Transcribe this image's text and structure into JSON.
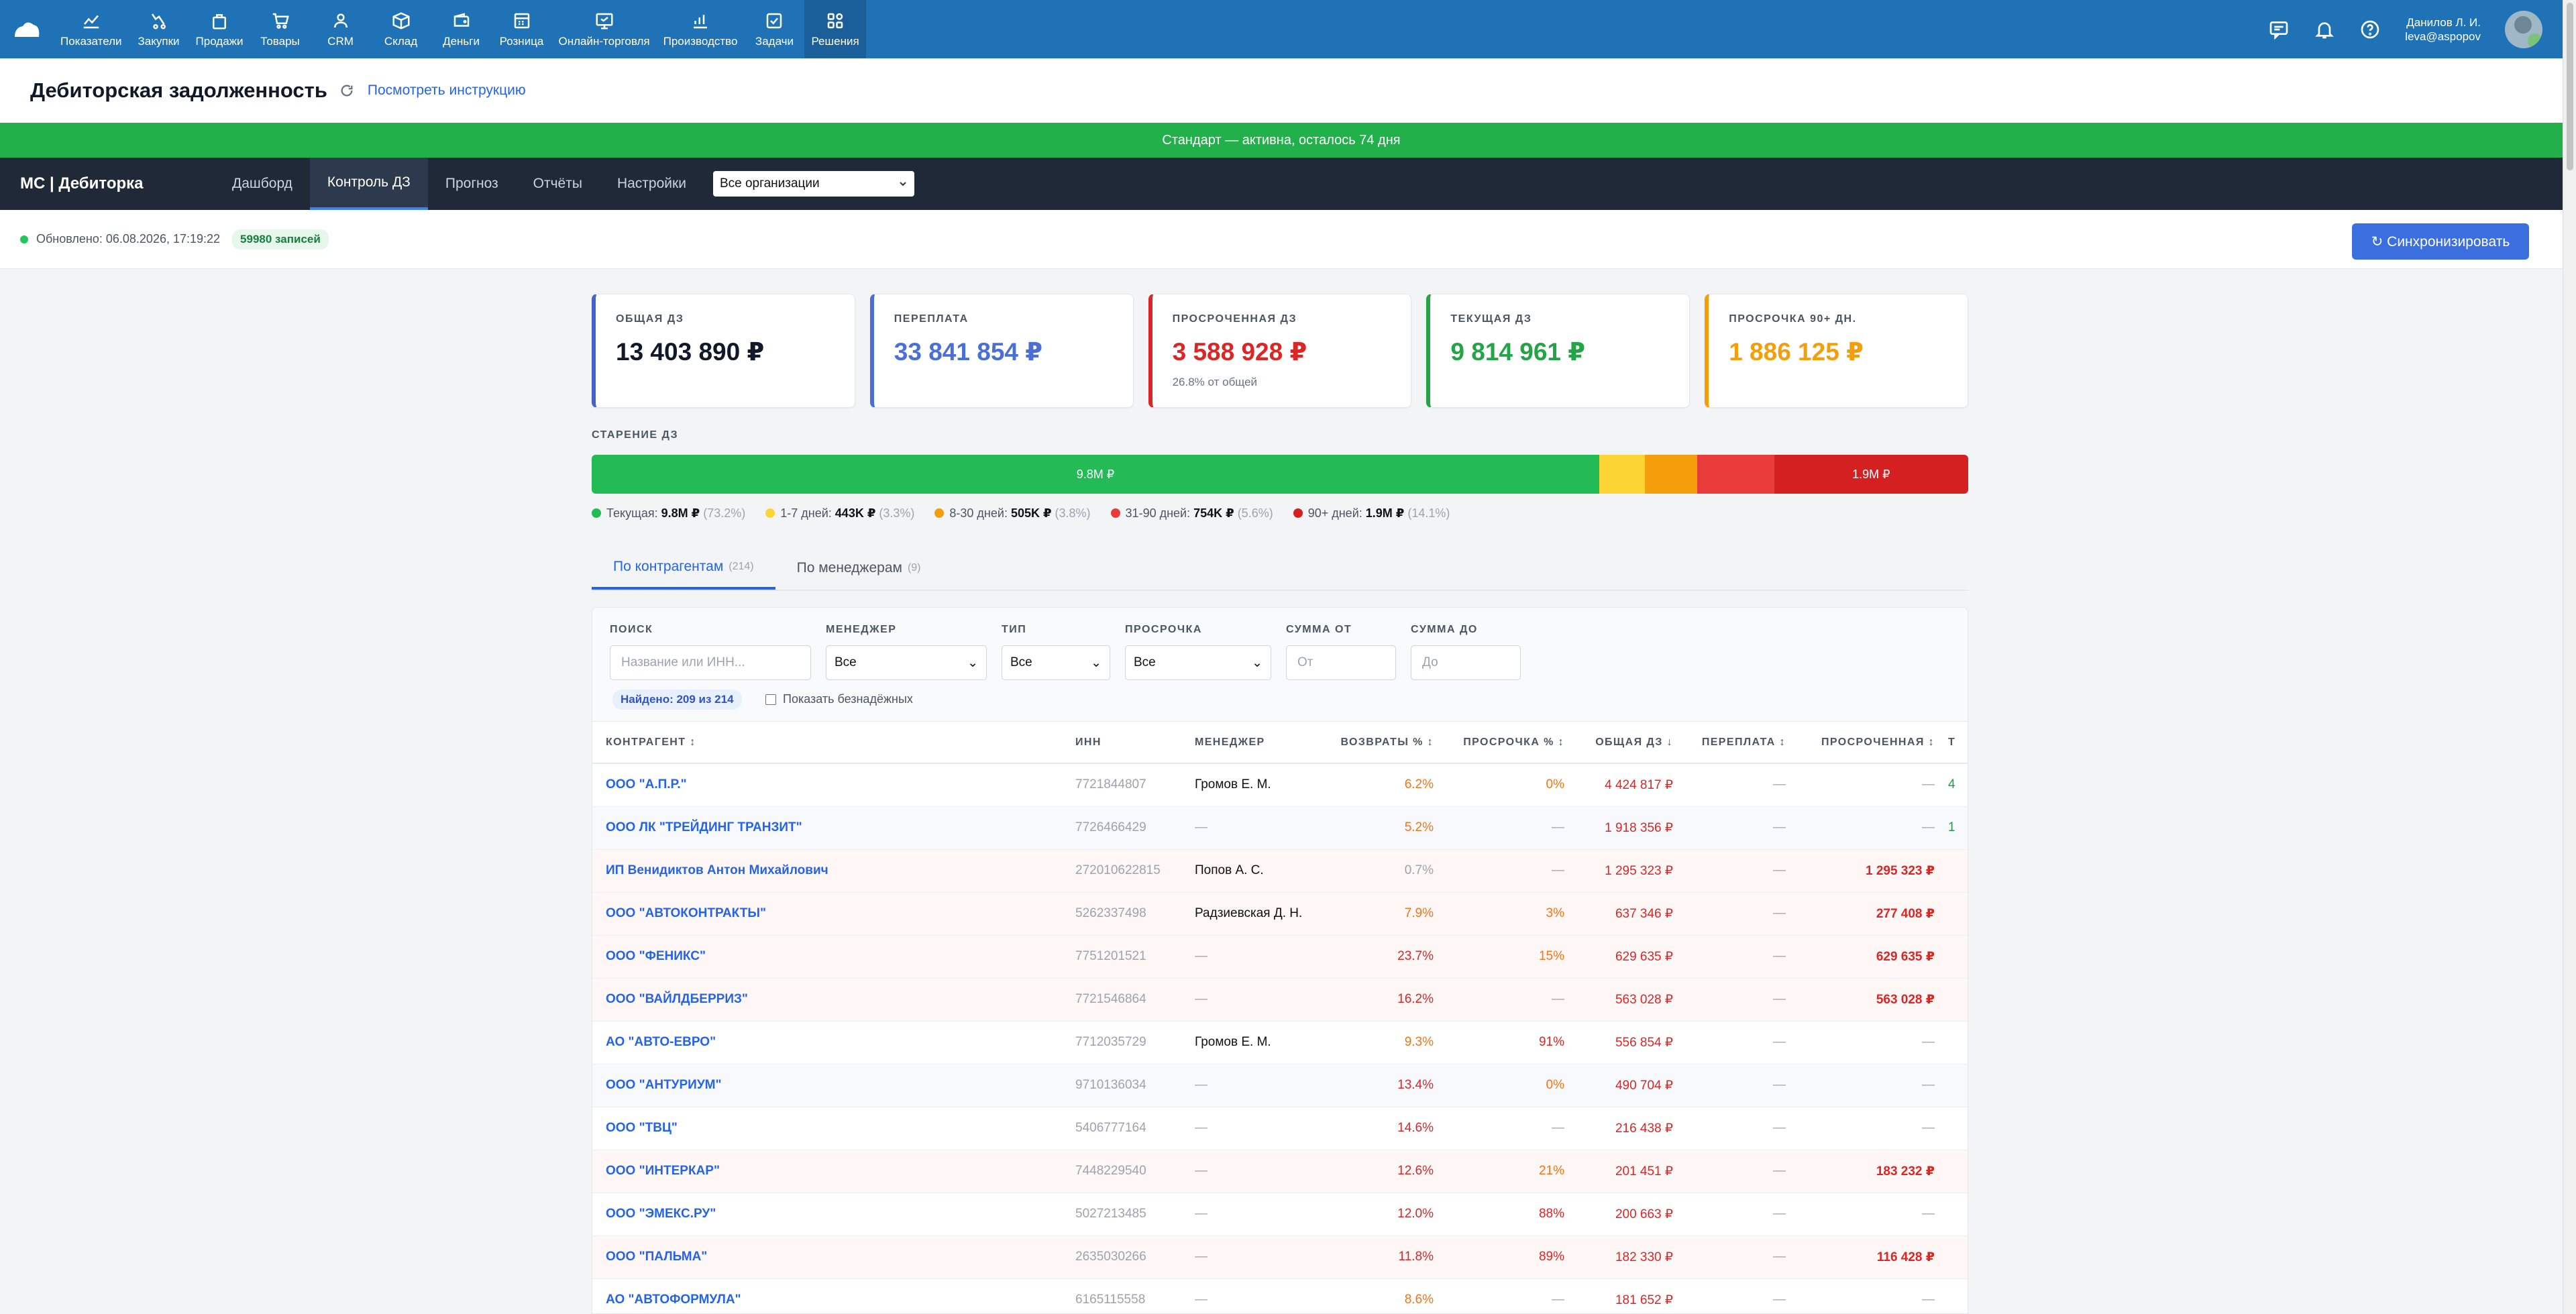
{
  "nav": {
    "items": [
      {
        "label": "Показатели",
        "icon": "chart-line-icon"
      },
      {
        "label": "Закупки",
        "icon": "purchases-icon"
      },
      {
        "label": "Продажи",
        "icon": "bag-icon"
      },
      {
        "label": "Товары",
        "icon": "cart-icon"
      },
      {
        "label": "CRM",
        "icon": "users-icon"
      },
      {
        "label": "Склад",
        "icon": "box-icon"
      },
      {
        "label": "Деньги",
        "icon": "wallet-icon"
      },
      {
        "label": "Розница",
        "icon": "register-icon"
      },
      {
        "label": "Онлайн-торговля",
        "icon": "online-store-icon"
      },
      {
        "label": "Производство",
        "icon": "bar-chart-icon"
      },
      {
        "label": "Задачи",
        "icon": "checkbox-icon"
      },
      {
        "label": "Решения",
        "icon": "apps-grid-icon"
      }
    ],
    "active_index": 11,
    "user_name": "Данилов Л. И.",
    "user_login": "leva@aspopov"
  },
  "page": {
    "title": "Дебиторская задолженность",
    "instruction_link": "Посмотреть инструкцию",
    "banner": "Стандарт — активна, осталось 74 дня"
  },
  "tabbar": {
    "brand": "МС | Дебиторка",
    "tabs": [
      "Дашборд",
      "Контроль ДЗ",
      "Прогноз",
      "Отчёты",
      "Настройки"
    ],
    "active_index": 1,
    "org_select": "Все организации"
  },
  "status": {
    "updated": "Обновлено: 06.08.2026, 17:19:22",
    "records": "59980 записей",
    "sync_button": "↻ Синхронизировать"
  },
  "cards": [
    {
      "label": "ОБЩАЯ ДЗ",
      "value": "13 403 890 ₽",
      "sub": "",
      "color": "#4263c7"
    },
    {
      "label": "ПЕРЕПЛАТА",
      "value": "33 841 854 ₽",
      "sub": "",
      "color": "#4a6fd6"
    },
    {
      "label": "ПРОСРОЧЕННАЯ ДЗ",
      "value": "3 588 928 ₽",
      "sub": "26.8% от общей",
      "color": "#dc2626"
    },
    {
      "label": "ТЕКУЩАЯ ДЗ",
      "value": "9 814 961 ₽",
      "sub": "",
      "color": "#22a447"
    },
    {
      "label": "ПРОСРОЧКА 90+ ДН.",
      "value": "1 886 125 ₽",
      "sub": "",
      "color": "#f59e0b"
    }
  ],
  "aging": {
    "title": "СТАРЕНИЕ ДЗ",
    "segments": [
      {
        "name": "Текущая",
        "amount": "9.8M ₽",
        "pct": "(73.2%)",
        "share": 73.2,
        "color": "#22bb55",
        "bar_label": "9.8M ₽"
      },
      {
        "name": "1-7 дней",
        "amount": "443K ₽",
        "pct": "(3.3%)",
        "share": 3.3,
        "color": "#fcd535",
        "bar_label": ""
      },
      {
        "name": "8-30 дней",
        "amount": "505K ₽",
        "pct": "(3.8%)",
        "share": 3.8,
        "color": "#f59e0b",
        "bar_label": ""
      },
      {
        "name": "31-90 дней",
        "amount": "754K ₽",
        "pct": "(5.6%)",
        "share": 5.6,
        "color": "#ea3b3b",
        "bar_label": ""
      },
      {
        "name": "90+ дней",
        "amount": "1.9M ₽",
        "pct": "(14.1%)",
        "share": 14.1,
        "color": "#d42020",
        "bar_label": "1.9M ₽"
      }
    ]
  },
  "subtabs": [
    {
      "label": "По контрагентам",
      "count": "(214)"
    },
    {
      "label": "По менеджерам",
      "count": "(9)"
    }
  ],
  "filters": {
    "search_label": "ПОИСК",
    "search_placeholder": "Название или ИНН...",
    "manager_label": "МЕНЕДЖЕР",
    "manager_value": "Все",
    "type_label": "ТИП",
    "type_value": "Все",
    "overdue_label": "ПРОСРОЧКА",
    "overdue_value": "Все",
    "sum_from_label": "СУММА ОТ",
    "sum_from_placeholder": "От",
    "sum_to_label": "СУММА ДО",
    "sum_to_placeholder": "До",
    "found": "Найдено: 209 из 214",
    "show_hopeless": "Показать безнадёжных"
  },
  "table": {
    "headers": [
      "КОНТРАГЕНТ ↕",
      "ИНН",
      "МЕНЕДЖЕР",
      "ВОЗВРАТЫ % ↕",
      "ПРОСРОЧКА % ↕",
      "ОБЩАЯ ДЗ ↓",
      "ПЕРЕПЛАТА ↕",
      "ПРОСРОЧЕННАЯ ↕",
      "Т"
    ],
    "rows": [
      {
        "name": "ООО \"А.П.Р.\"",
        "inn": "7721844807",
        "manager": "Громов Е. М.",
        "returns": "6.2%",
        "overdue_pct": "0%",
        "total": "4 424 817 ₽",
        "overpay": "—",
        "overdue": "—",
        "extra": "4"
      },
      {
        "name": "ООО ЛК \"ТРЕЙДИНГ ТРАНЗИТ\"",
        "inn": "7726466429",
        "manager": "—",
        "returns": "5.2%",
        "overdue_pct": "—",
        "total": "1 918 356 ₽",
        "overpay": "—",
        "overdue": "—",
        "extra": "1"
      },
      {
        "name": "ИП Венидиктов Антон Михайлович",
        "inn": "272010622815",
        "manager": "Попов А. С.",
        "returns": "0.7%",
        "overdue_pct": "—",
        "total": "1 295 323 ₽",
        "overpay": "—",
        "overdue": "1 295 323 ₽",
        "extra": ""
      },
      {
        "name": "ООО \"АВТОКОНТРАКТЫ\"",
        "inn": "5262337498",
        "manager": "Радзиевская Д. Н.",
        "returns": "7.9%",
        "overdue_pct": "3%",
        "total": "637 346 ₽",
        "overpay": "—",
        "overdue": "277 408 ₽",
        "extra": ""
      },
      {
        "name": "ООО \"ФЕНИКС\"",
        "inn": "7751201521",
        "manager": "—",
        "returns": "23.7%",
        "overdue_pct": "15%",
        "total": "629 635 ₽",
        "overpay": "—",
        "overdue": "629 635 ₽",
        "extra": ""
      },
      {
        "name": "ООО \"ВАЙЛДБЕРРИЗ\"",
        "inn": "7721546864",
        "manager": "—",
        "returns": "16.2%",
        "overdue_pct": "—",
        "total": "563 028 ₽",
        "overpay": "—",
        "overdue": "563 028 ₽",
        "extra": ""
      },
      {
        "name": "АО \"АВТО-ЕВРО\"",
        "inn": "7712035729",
        "manager": "Громов Е. М.",
        "returns": "9.3%",
        "overdue_pct": "91%",
        "total": "556 854 ₽",
        "overpay": "—",
        "overdue": "—",
        "extra": ""
      },
      {
        "name": "ООО \"АНТУРИУМ\"",
        "inn": "9710136034",
        "manager": "—",
        "returns": "13.4%",
        "overdue_pct": "0%",
        "total": "490 704 ₽",
        "overpay": "—",
        "overdue": "—",
        "extra": ""
      },
      {
        "name": "ООО \"ТВЦ\"",
        "inn": "5406777164",
        "manager": "—",
        "returns": "14.6%",
        "overdue_pct": "—",
        "total": "216 438 ₽",
        "overpay": "—",
        "overdue": "—",
        "extra": ""
      },
      {
        "name": "ООО \"ИНТЕРКАР\"",
        "inn": "7448229540",
        "manager": "—",
        "returns": "12.6%",
        "overdue_pct": "21%",
        "total": "201 451 ₽",
        "overpay": "—",
        "overdue": "183 232 ₽",
        "extra": ""
      },
      {
        "name": "ООО \"ЭМЕКС.РУ\"",
        "inn": "5027213485",
        "manager": "—",
        "returns": "12.0%",
        "overdue_pct": "88%",
        "total": "200 663 ₽",
        "overpay": "—",
        "overdue": "—",
        "extra": ""
      },
      {
        "name": "ООО \"ПАЛЬМА\"",
        "inn": "2635030266",
        "manager": "—",
        "returns": "11.8%",
        "overdue_pct": "89%",
        "total": "182 330 ₽",
        "overpay": "—",
        "overdue": "116 428 ₽",
        "extra": ""
      },
      {
        "name": "АО \"АВТОФОРМУЛА\"",
        "inn": "6165115558",
        "manager": "—",
        "returns": "8.6%",
        "overdue_pct": "—",
        "total": "181 652 ₽",
        "overpay": "—",
        "overdue": "—",
        "extra": ""
      }
    ]
  }
}
